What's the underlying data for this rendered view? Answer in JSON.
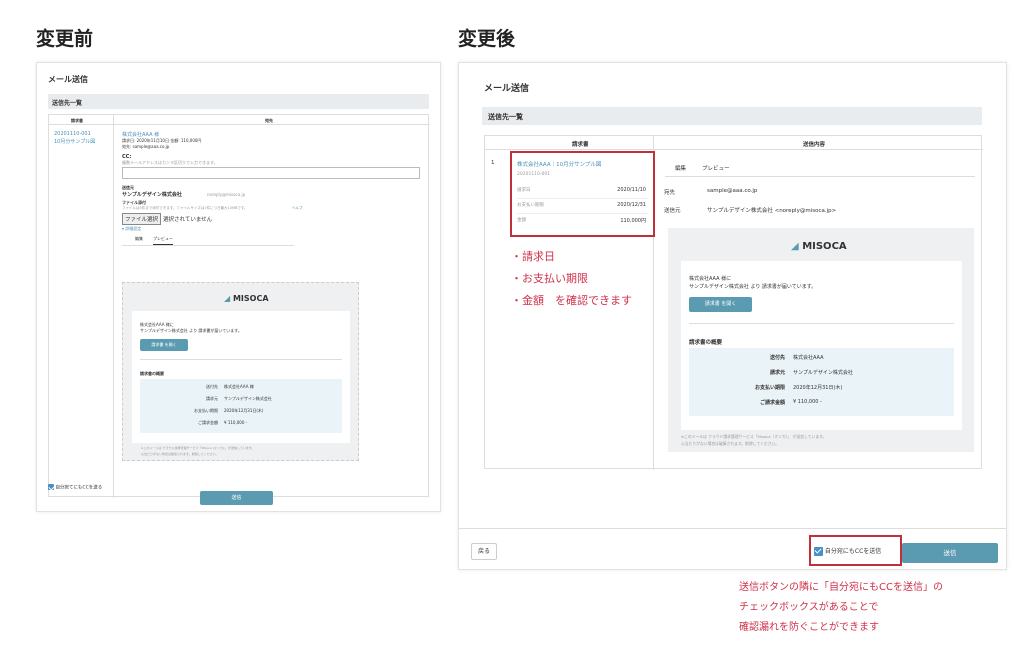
{
  "before": {
    "heading": "変更前",
    "title": "メール送信",
    "section": "送信先一覧",
    "col_invoice": "請求書",
    "col_to": "宛先",
    "invoice_id": "20201110-001",
    "invoice_title": "10月分サンプル図",
    "recipient": "株式会社AAA 様",
    "recipient_details": "請求日: 2020年11月10日 金額: 110,000円",
    "recipient_email": "宛先: sample@aaa.co.jp",
    "cc_label": "CC:",
    "cc_hint": "複数メールアドレスはカンマ区切りで入力できます。",
    "cc_value": "",
    "sender_label": "送信元",
    "sender_name": "サンプルデザイン株式会社",
    "sender_email": "noreply@misoca.jp",
    "attach_label": "ファイル添付",
    "attach_hint": "ファイルは5件まで添付できます。ファイルサイズは1件につき最大10MBです。",
    "attach_help": "ヘルプ",
    "file_button": "ファイル選択",
    "file_status": "選択されていません",
    "advanced": "▾ 詳細設定",
    "tab_edit": "編集",
    "tab_preview": "プレビュー",
    "logo": "MISOCA",
    "mail_to": "株式会社AAA 様に",
    "mail_body": "サンプルデザイン株式会社 より 請求書が届いています。",
    "open_button": "請求書 を開く",
    "summary_title": "請求書の概要",
    "summary": [
      {
        "k": "送付先",
        "v": "株式会社AAA 様"
      },
      {
        "k": "請求元",
        "v": "サンプルデザイン株式会社"
      },
      {
        "k": "お支払い期限",
        "v": "2020年12月31日(木)"
      },
      {
        "k": "ご請求金額",
        "v": "¥ 110,000 -"
      }
    ],
    "footer_note": "※このメールは クラウド請求管理サービス「Misoca (ミソカ)」 が送信しています。",
    "footer_note2": "心当たりがない場合は破棄されます。削除してください。",
    "cc_self": "自分宛てにもCCを送る",
    "send_button": "送信"
  },
  "after": {
    "heading": "変更後",
    "title": "メール送信",
    "section": "送信先一覧",
    "col_invoice": "請求書",
    "col_content": "送信内容",
    "row_no": "1",
    "invoice_link": "株式会社AAA｜10月分サンプル図",
    "invoice_id": "20201110-001",
    "fields": [
      {
        "k": "請求日",
        "v": "2020/11/10"
      },
      {
        "k": "お支払い期限",
        "v": "2020/12/31"
      },
      {
        "k": "金額",
        "v": "110,000円"
      }
    ],
    "tab_edit": "編集",
    "tab_preview": "プレビュー",
    "to_label": "宛先",
    "to_value": "sample@aaa.co.jp",
    "from_label": "送信元",
    "from_value": "サンプルデザイン株式会社 <noreply@misoca.jp>",
    "logo": "MISOCA",
    "mail_to": "株式会社AAA 様に",
    "mail_body": "サンプルデザイン株式会社 より 請求書が届いています。",
    "open_button": "請求書 を開く",
    "summary_title": "請求書の概要",
    "summary": [
      {
        "k": "送付先",
        "v": "株式会社AAA"
      },
      {
        "k": "請求元",
        "v": "サンプルデザイン株式会社"
      },
      {
        "k": "お支払い期限",
        "v": "2020年12月31日(木)"
      },
      {
        "k": "ご請求金額",
        "v": "¥ 110,000 -"
      }
    ],
    "footer_note": "※このメールは クラウド請求管理サービス「Misoca（ミソカ）」 が送信しています。",
    "footer_note2": "心当たりがない場合は破棄されます。削除してください。",
    "back_button": "戻る",
    "cc_self": "自分宛にもCCを送信",
    "send_button": "送信"
  },
  "annotations": {
    "left_lines": [
      "・請求日",
      "・お支払い期限",
      "・金額　を確認できます"
    ],
    "bottom_lines": [
      "送信ボタンの隣に「自分宛にもCCを送信」の",
      "チェックボックスがあることで",
      "確認漏れを防ぐことができます"
    ]
  },
  "colors": {
    "accent": "#5b9bb1",
    "link": "#4a90b8",
    "annotation": "#d0304a",
    "highlight_border": "#c0303a",
    "section_bg": "#e8ecef"
  }
}
